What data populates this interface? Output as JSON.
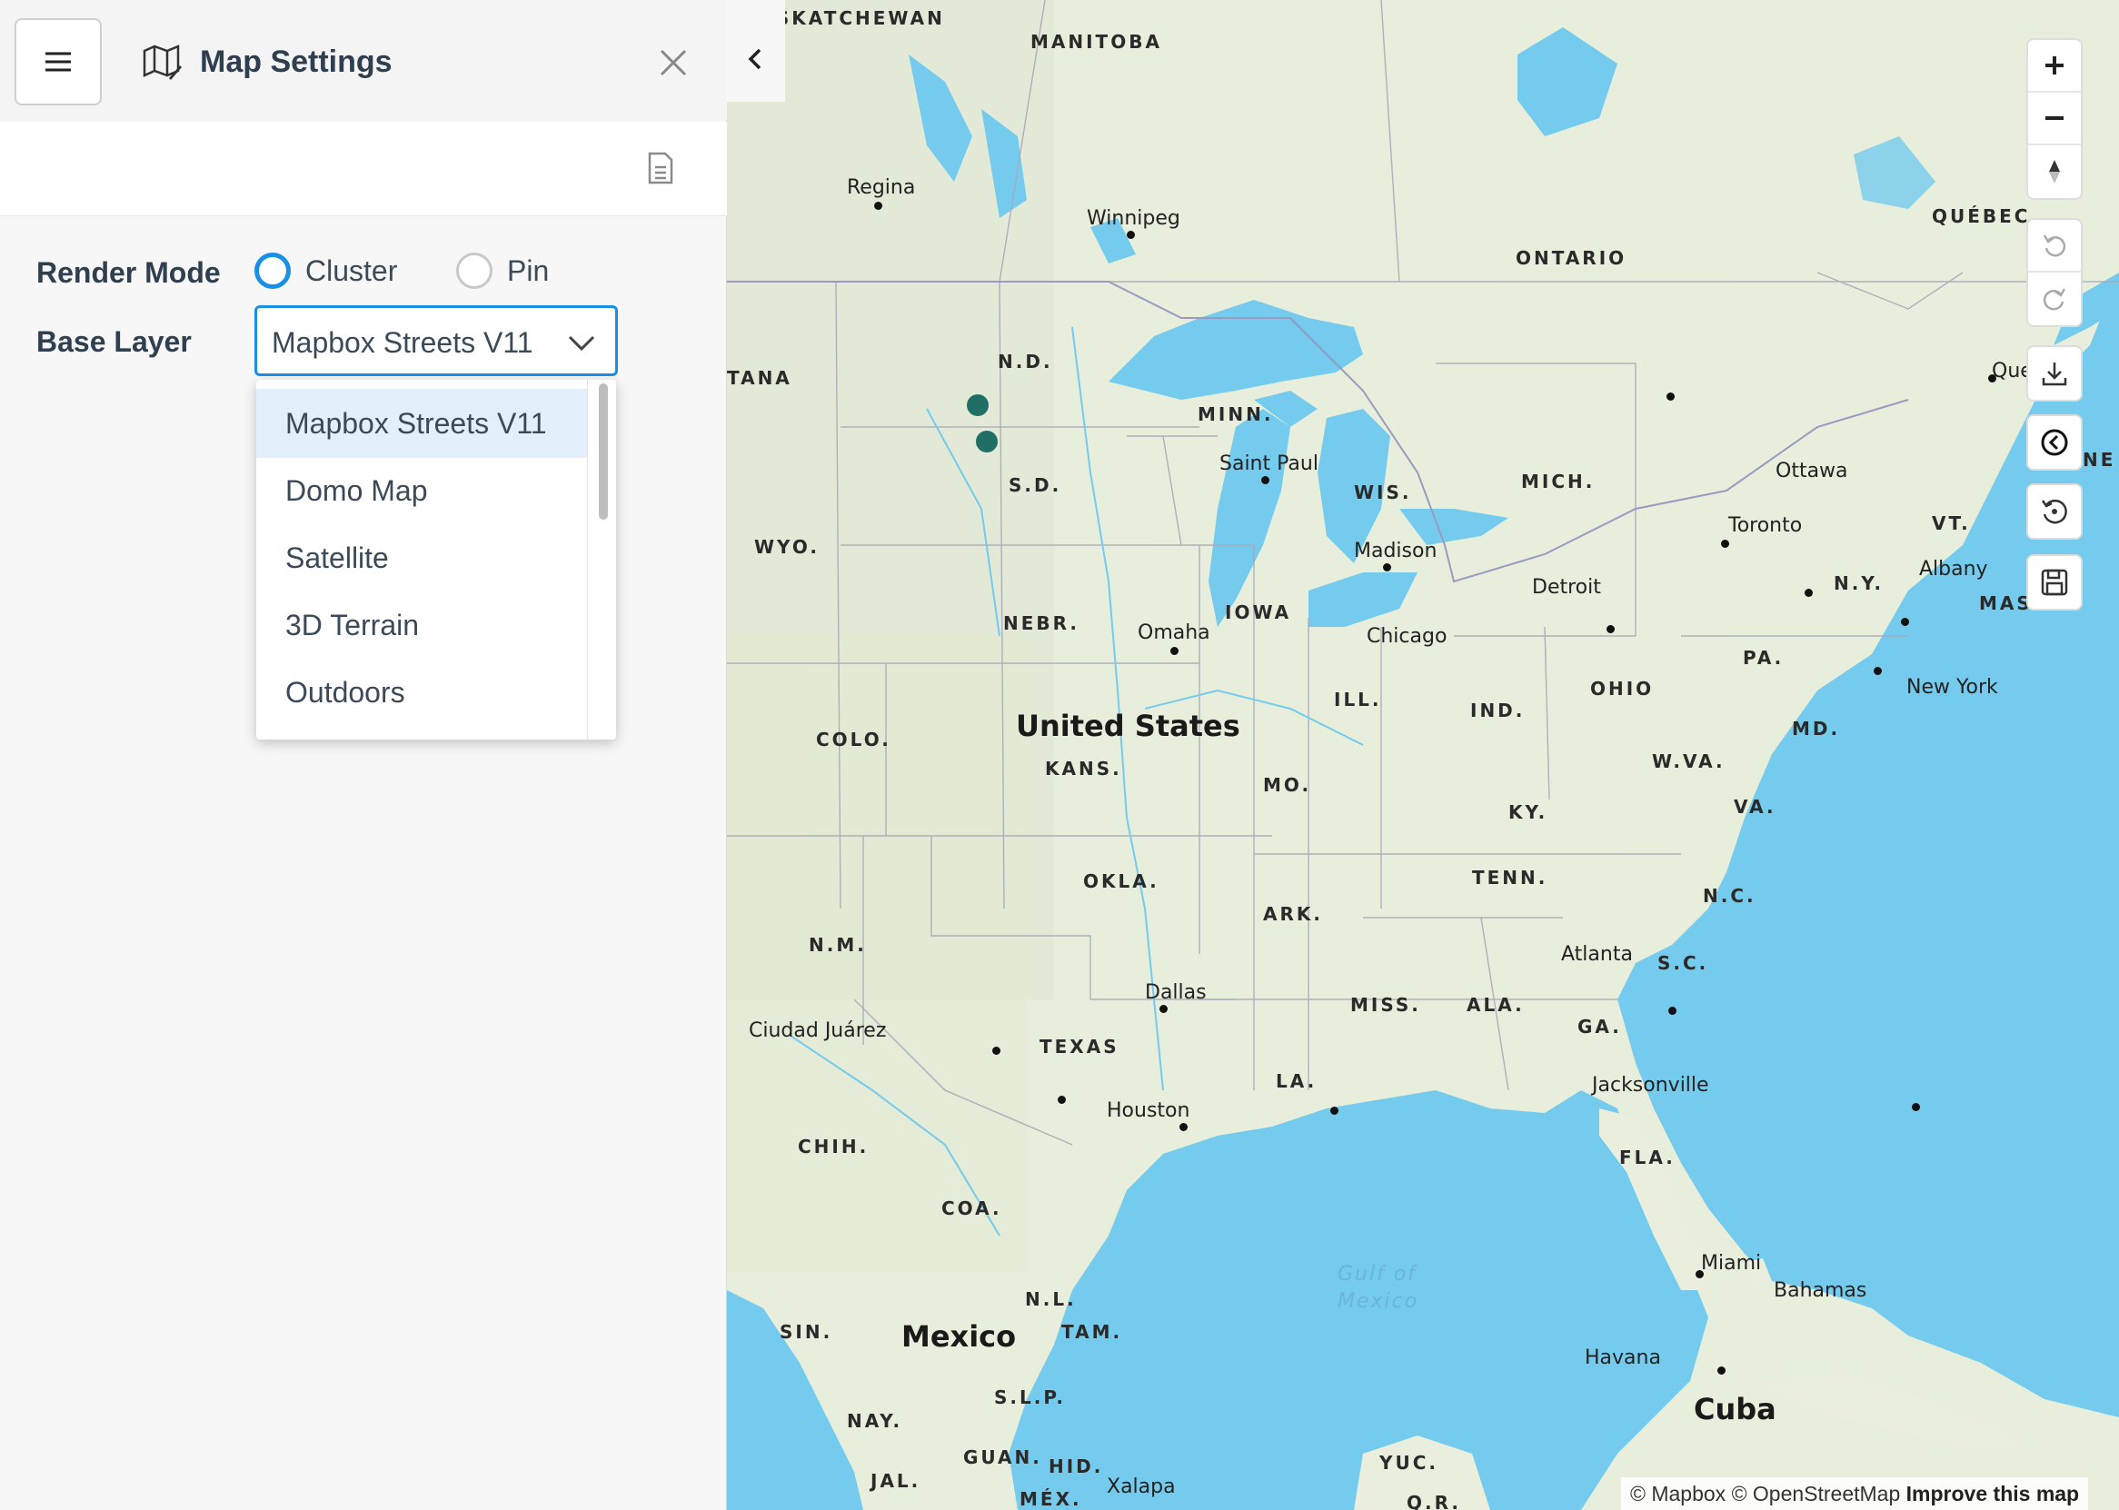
{
  "panel": {
    "title": "Map Settings",
    "render_mode_label": "Render Mode",
    "render_options": [
      {
        "label": "Cluster",
        "selected": true
      },
      {
        "label": "Pin",
        "selected": false
      }
    ],
    "base_layer_label": "Base Layer",
    "base_layer_value": "Mapbox Streets V11",
    "base_layer_options": [
      "Mapbox Streets V11",
      "Domo Map",
      "Satellite",
      "3D Terrain",
      "Outdoors"
    ],
    "icons": [
      "hamburger-menu-icon",
      "map-edit-icon",
      "close-icon",
      "document-icon",
      "chevron-down-icon"
    ]
  },
  "map": {
    "labels": {
      "saskatchewan": "SASKATCHEWAN",
      "manitoba": "MANITOBA",
      "ontario": "ONTARIO",
      "quebec_prov": "QUÉBEC",
      "regina": "Regina",
      "winnipeg": "Winnipeg",
      "quebec_city": "Quebec",
      "ottawa": "Ottawa",
      "toronto": "Toronto",
      "montana": "TANA",
      "nd": "N.D.",
      "minn": "MINN.",
      "sd": "S.D.",
      "wyo": "WYO.",
      "wis": "WIS.",
      "mich": "MICH.",
      "saint_paul": "Saint Paul",
      "madison": "Madison",
      "detroit": "Detroit",
      "vt": "VT.",
      "ny": "N.Y.",
      "albany": "Albany",
      "mass": "MASS.",
      "maine": "NE",
      "nebr": "NEBR.",
      "omaha": "Omaha",
      "iowa": "IOWA",
      "chicago": "Chicago",
      "pa": "PA.",
      "new_york": "New York",
      "colo": "COLO.",
      "united_states": "United States",
      "kans": "KANS.",
      "ill": "ILL.",
      "ind": "IND.",
      "ohio": "OHIO",
      "md": "MD.",
      "wva": "W.VA.",
      "mo": "MO.",
      "ky": "KY.",
      "va": "VA.",
      "okla": "OKLA.",
      "tenn": "TENN.",
      "nc": "N.C.",
      "nm": "N.M.",
      "ark": "ARK.",
      "atlanta": "Atlanta",
      "sc": "S.C.",
      "dallas": "Dallas",
      "miss": "MISS.",
      "ala": "ALA.",
      "ciudad_juarez": "Ciudad Juárez",
      "texas": "TEXAS",
      "ga": "GA.",
      "la": "LA.",
      "jacksonville": "Jacksonville",
      "houston": "Houston",
      "chih": "CHIH.",
      "fla": "FLA.",
      "coa": "COA.",
      "gulf_1": "Gulf of",
      "gulf_2": "Mexico",
      "miami": "Miami",
      "nl": "N.L.",
      "bahamas": "Bahamas",
      "sin": "SIN.",
      "mexico": "Mexico",
      "tam": "TAM.",
      "havana": "Havana",
      "slp": "S.L.P.",
      "cuba": "Cuba",
      "nay": "NAY.",
      "guan": "GUAN.",
      "hid": "HID.",
      "yuc": "YUC.",
      "jal": "JAL.",
      "mex": "MÉX.",
      "xalapa": "Xalapa",
      "qr": "Q.R."
    },
    "attribution": {
      "mapbox": "© Mapbox",
      "osm": "© OpenStreetMap",
      "improve": "Improve this map"
    },
    "controls": [
      "zoom-in-icon",
      "zoom-out-icon",
      "compass-icon",
      "undo-icon",
      "redo-icon",
      "download-icon",
      "back-circle-icon",
      "reset-icon",
      "save-icon"
    ],
    "colors": {
      "land": "#e9efdc",
      "water": "#74cbee",
      "pin": "#1f6f66",
      "accent": "#1a8fe6"
    }
  }
}
